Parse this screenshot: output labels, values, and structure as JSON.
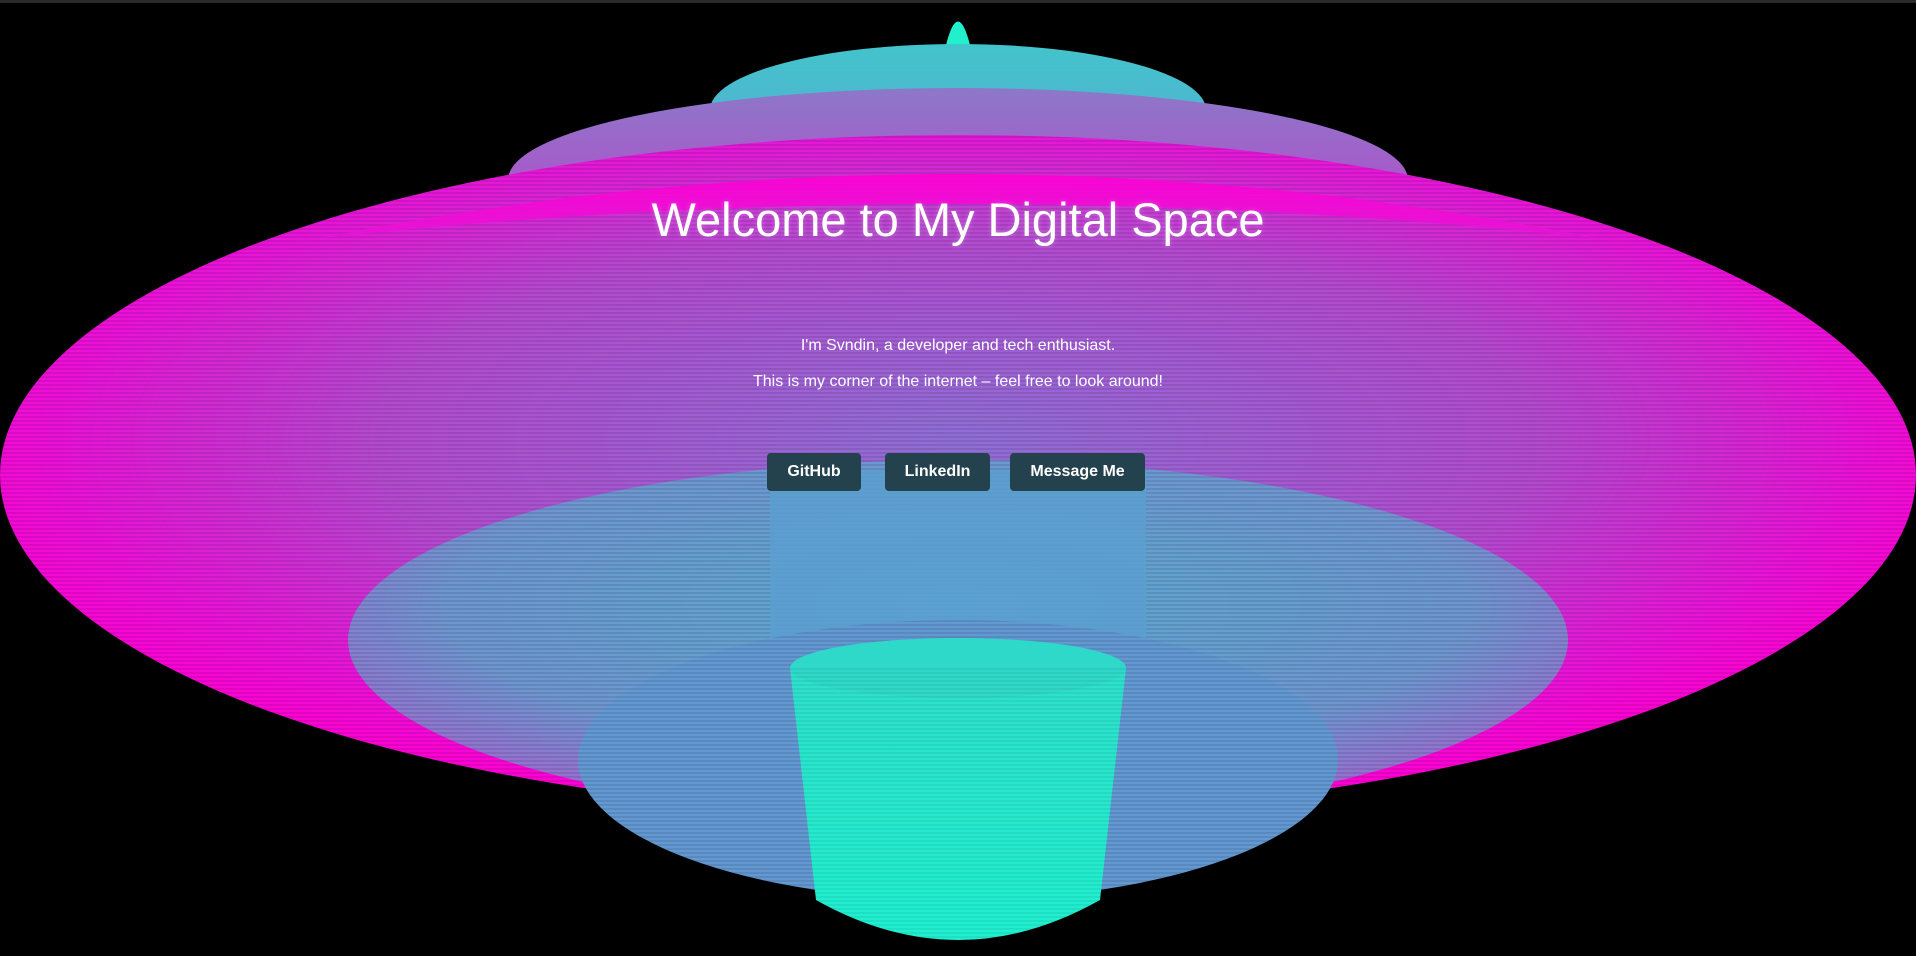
{
  "hero": {
    "title": "Welcome to My Digital Space",
    "intro": "I'm Svndin, a developer and tech enthusiast.",
    "tagline": "This is my corner of the internet – feel free to look around!"
  },
  "buttons": {
    "github": "GitHub",
    "linkedin": "LinkedIn",
    "message": "Message Me"
  },
  "theme": {
    "background": "#000000",
    "magenta": "#ff00d4",
    "violet": "#a865cc",
    "cyan": "#1de9c9",
    "button_bg": "#24414e"
  }
}
